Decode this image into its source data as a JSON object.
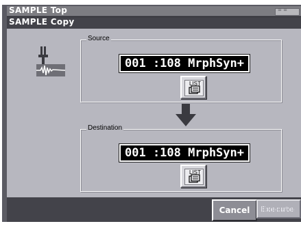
{
  "window": {
    "title": "SAMPLE Top",
    "subtitle": "SAMPLE Copy"
  },
  "source": {
    "legend": "Source",
    "value": "001 :108  MrphSyn+",
    "list_label": "LIST"
  },
  "destination": {
    "legend": "Destination",
    "value": "001 :108  MrphSyn+",
    "list_label": "LIST"
  },
  "buttons": {
    "cancel": "Cancel",
    "execute": "Execute"
  },
  "icons": {
    "logo": "wrench-waveform-icon",
    "arrow": "arrow-down-icon",
    "list": "list-icon"
  },
  "colors": {
    "panel": "#b7b7bf",
    "title_bar": "#7d7d82",
    "sub_bar": "#43434a",
    "value_bg": "#000000",
    "value_fg": "#ffffff"
  }
}
